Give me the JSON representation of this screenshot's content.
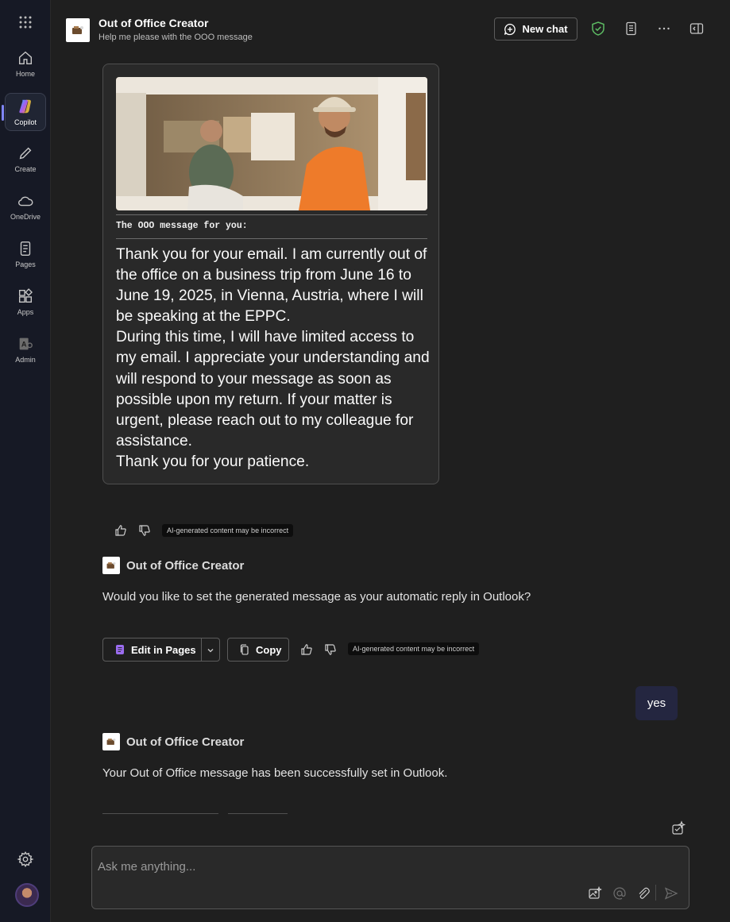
{
  "rail": {
    "items": [
      {
        "label": "Home"
      },
      {
        "label": "Copilot"
      },
      {
        "label": "Create"
      },
      {
        "label": "OneDrive"
      },
      {
        "label": "Pages"
      },
      {
        "label": "Apps"
      },
      {
        "label": "Admin"
      }
    ],
    "active": "Copilot"
  },
  "header": {
    "title": "Out of Office Creator",
    "subtitle": "Help me please with the OOO message",
    "new_chat_label": "New chat"
  },
  "card": {
    "label": "The OOO message for you:",
    "lines": [
      "Thank you for your email. I am currently out of the office on a business trip from June 16 to June 19, 2025, in Vienna, Austria, where I will be speaking at the EPPC.",
      "During this time, I will have limited access to my email. I appreciate your understanding and will respond to your message as soon as possible upon my return. If your matter is urgent, please reach out to my colleague for assistance.",
      "Thank you for your patience."
    ]
  },
  "ai_disclaimer": "AI-generated content may be incorrect",
  "messages": [
    {
      "sender": "Out of Office Creator",
      "text": "Would you like to set the generated message as your automatic reply in Outlook?"
    },
    {
      "sender": "Out of Office Creator",
      "text": "Your Out of Office message has been successfully set in Outlook."
    }
  ],
  "actions": {
    "edit_in_pages": "Edit in Pages",
    "copy": "Copy"
  },
  "user_message": "yes",
  "compose": {
    "placeholder": "Ask me anything..."
  },
  "colors": {
    "accent": "#7f85f5",
    "shield": "#5dbb63",
    "user_bubble": "#242640"
  }
}
